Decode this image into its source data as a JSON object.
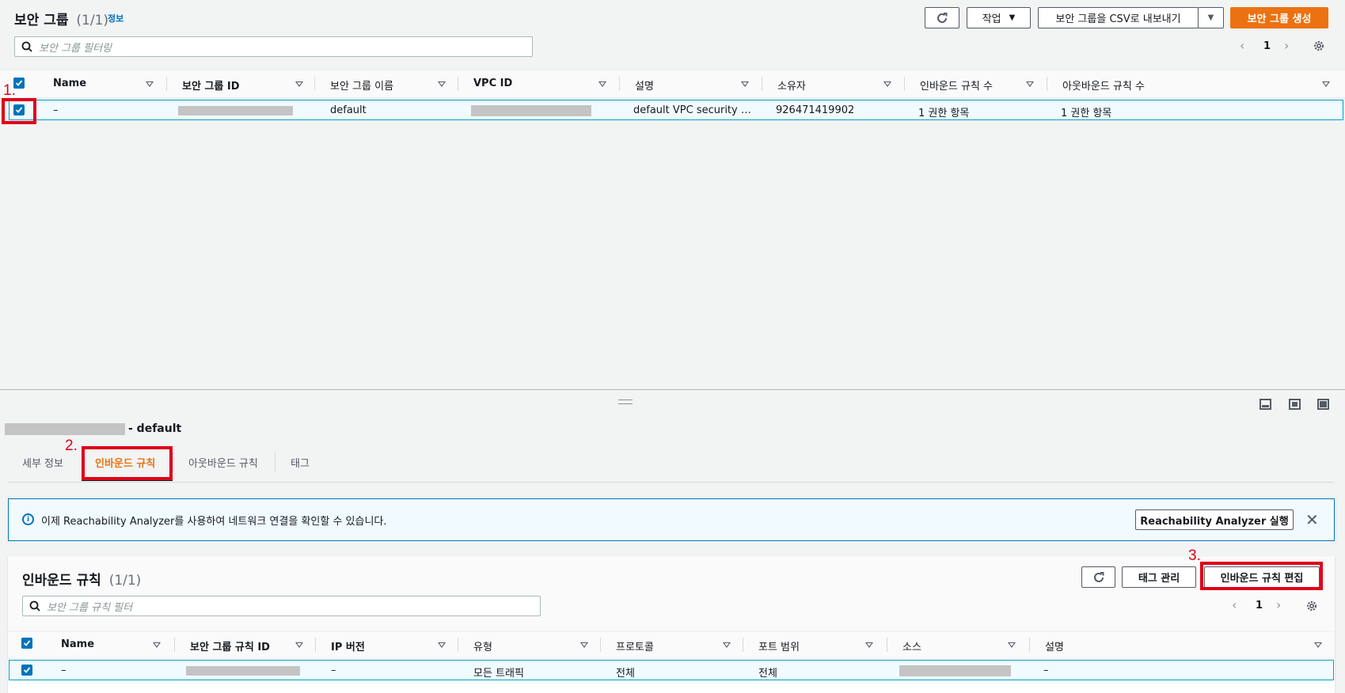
{
  "top": {
    "title": "보안 그룹",
    "count": "(1/1)",
    "info_link": "정보",
    "actions_label": "작업",
    "export_label": "보안 그룹을 CSV로 내보내기",
    "create_label": "보안 그룹 생성",
    "search_placeholder": "보안 그룹 필터링",
    "page": "1",
    "columns": [
      "Name",
      "보안 그룹 ID",
      "보안 그룹 이름",
      "VPC ID",
      "설명",
      "소유자",
      "인바운드 규칙 수",
      "아웃바운드 규칙 수"
    ],
    "row": {
      "name": "–",
      "group_name": "default",
      "description": "default VPC security gr…",
      "owner": "926471419902",
      "inbound_count": "1 권한 항목",
      "outbound_count": "1 권한 항목"
    }
  },
  "detail": {
    "selected_suffix": "- default",
    "tabs": [
      "세부 정보",
      "인바운드 규칙",
      "아웃바운드 규칙",
      "태그"
    ],
    "info_text": "이제 Reachability Analyzer를 사용하여 네트워크 연결을 확인할 수 있습니다.",
    "reachability_button": "Reachability Analyzer 실행",
    "inbound_title": "인바운드 규칙",
    "inbound_count": "(1/1)",
    "manage_tags_label": "태그 관리",
    "edit_inbound_label": "인바운드 규칙 편집",
    "search_placeholder": "보안 그룹 규칙 필터",
    "page": "1",
    "columns": [
      "Name",
      "보안 그룹 규칙 ID",
      "IP 버전",
      "유형",
      "프로토콜",
      "포트 범위",
      "소스",
      "설명"
    ],
    "row": {
      "name": "–",
      "ip_version": "–",
      "type": "모든 트래픽",
      "protocol": "전체",
      "port_range": "전체",
      "description": "–"
    }
  },
  "annotations": [
    "1.",
    "2.",
    "3."
  ],
  "colors": {
    "accent": "#0073bb",
    "primary_button": "#ec7211",
    "highlight_box": "#e0001a"
  }
}
